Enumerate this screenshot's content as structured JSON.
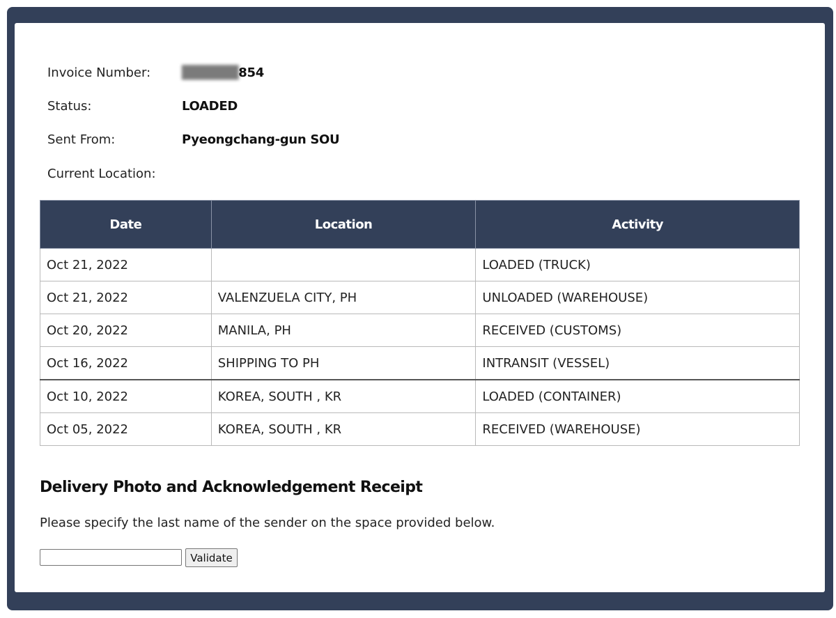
{
  "shipment": {
    "invoice_label": "Invoice Number:",
    "invoice_value": "854",
    "status_label": "Status:",
    "status_value": "LOADED",
    "sent_from_label": "Sent From:",
    "sent_from_value": "Pyeongchang-gun SOU",
    "current_location_label": "Current Location:",
    "current_location_value": ""
  },
  "table": {
    "headers": [
      "Date",
      "Location",
      "Activity"
    ],
    "rows": [
      {
        "date": "Oct 21, 2022",
        "location": "",
        "activity": "LOADED (TRUCK)"
      },
      {
        "date": "Oct 21, 2022",
        "location": "VALENZUELA CITY, PH",
        "activity": "UNLOADED (WAREHOUSE)"
      },
      {
        "date": "Oct 20, 2022",
        "location": "MANILA, PH",
        "activity": "RECEIVED (CUSTOMS)"
      },
      {
        "date": "Oct 16, 2022",
        "location": "SHIPPING TO PH",
        "activity": "INTRANSIT (VESSEL)"
      },
      {
        "date": "Oct 10, 2022",
        "location": "KOREA, SOUTH , KR",
        "activity": "LOADED (CONTAINER)"
      },
      {
        "date": "Oct 05, 2022",
        "location": "KOREA, SOUTH , KR",
        "activity": "RECEIVED (WAREHOUSE)"
      }
    ]
  },
  "delivery": {
    "title": "Delivery Photo and Acknowledgement Receipt",
    "instruction": "Please specify the last name of the sender on the space provided below.",
    "input_value": "",
    "validate_label": "Validate"
  },
  "colors": {
    "frame": "#334059",
    "header_bg": "#334059",
    "header_text": "#ffffff"
  }
}
